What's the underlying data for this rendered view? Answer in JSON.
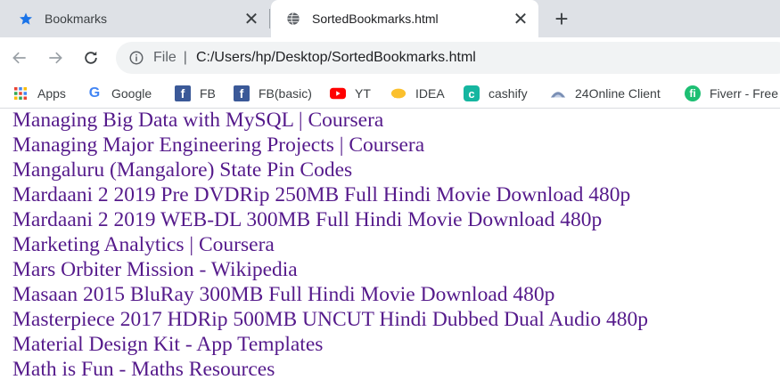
{
  "tabs": [
    {
      "title": "Bookmarks",
      "icon": "star-icon"
    },
    {
      "title": "SortedBookmarks.html",
      "icon": "globe-icon"
    }
  ],
  "omnibox": {
    "scheme": "File",
    "separator": "|",
    "url": "C:/Users/hp/Desktop/SortedBookmarks.html"
  },
  "bookmarks_bar": [
    {
      "label": "Apps",
      "icon": "apps-grid-icon"
    },
    {
      "label": "Google",
      "icon": "google-icon"
    },
    {
      "label": "FB",
      "icon": "facebook-icon"
    },
    {
      "label": "FB(basic)",
      "icon": "facebook-icon"
    },
    {
      "label": "YT",
      "icon": "youtube-icon"
    },
    {
      "label": "IDEA",
      "icon": "idea-icon"
    },
    {
      "label": "cashify",
      "icon": "cashify-icon"
    },
    {
      "label": "24Online Client",
      "icon": "24online-icon"
    },
    {
      "label": "Fiverr - Free",
      "icon": "fiverr-icon"
    }
  ],
  "links": [
    "Managing Big Data with MySQL | Coursera",
    "Managing Major Engineering Projects | Coursera",
    "Mangaluru (Mangalore) State Pin Codes",
    "Mardaani 2 2019 Pre DVDRip 250MB Full Hindi Movie Download 480p",
    "Mardaani 2 2019 WEB-DL 300MB Full Hindi Movie Download 480p",
    "Marketing Analytics | Coursera",
    "Mars Orbiter Mission - Wikipedia",
    "Masaan 2015 BluRay 300MB Full Hindi Movie Download 480p",
    "Masterpiece 2017 HDRip 500MB UNCUT Hindi Dubbed Dual Audio 480p",
    "Material Design Kit - App Templates",
    "Math is Fun - Maths Resources"
  ],
  "colors": {
    "tabstrip": "#dee1e6",
    "visited_link": "#551a8b",
    "omnibox_bg": "#f1f3f4"
  }
}
